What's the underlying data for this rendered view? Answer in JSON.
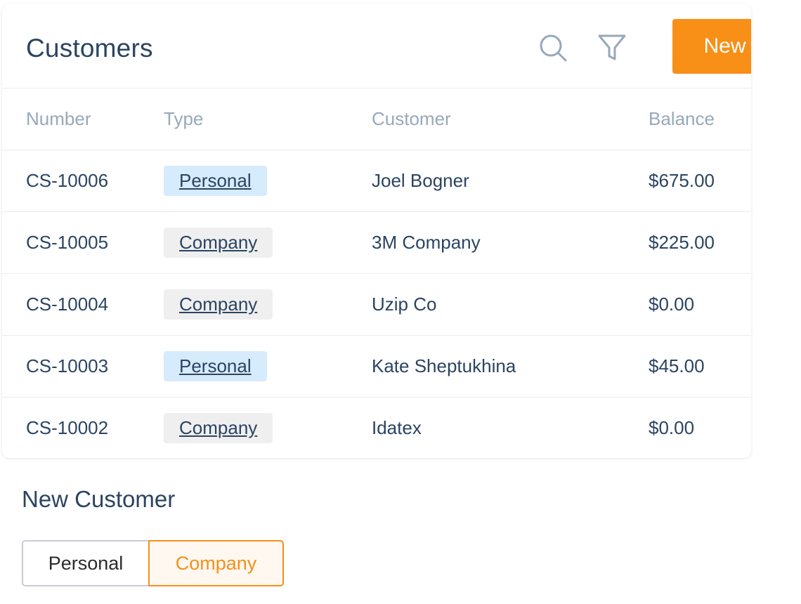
{
  "header": {
    "title": "Customers",
    "search_icon": "search-icon",
    "filter_icon": "filter-icon",
    "new_label": "New"
  },
  "table": {
    "columns": [
      "Number",
      "Type",
      "Customer",
      "Balance"
    ],
    "rows": [
      {
        "number": "CS-10006",
        "type": "Personal",
        "customer": "Joel Bogner",
        "balance": "$675.00"
      },
      {
        "number": "CS-10005",
        "type": "Company",
        "customer": "3M Company",
        "balance": "$225.00"
      },
      {
        "number": "CS-10004",
        "type": "Company",
        "customer": "Uzip Co",
        "balance": "$0.00"
      },
      {
        "number": "CS-10003",
        "type": "Personal",
        "customer": "Kate Sheptukhina",
        "balance": "$45.00"
      },
      {
        "number": "CS-10002",
        "type": "Company",
        "customer": "Idatex",
        "balance": "$0.00"
      }
    ]
  },
  "new_customer": {
    "title": "New Customer",
    "options": [
      "Personal",
      "Company"
    ],
    "selected": "Company"
  },
  "colors": {
    "accent": "#f88f17",
    "title_text": "#2b4462",
    "header_text": "#98a8ba",
    "negative_balance": "#f23c3c",
    "personal_tag_bg": "#d6ebfb",
    "company_tag_bg": "#efefef"
  }
}
